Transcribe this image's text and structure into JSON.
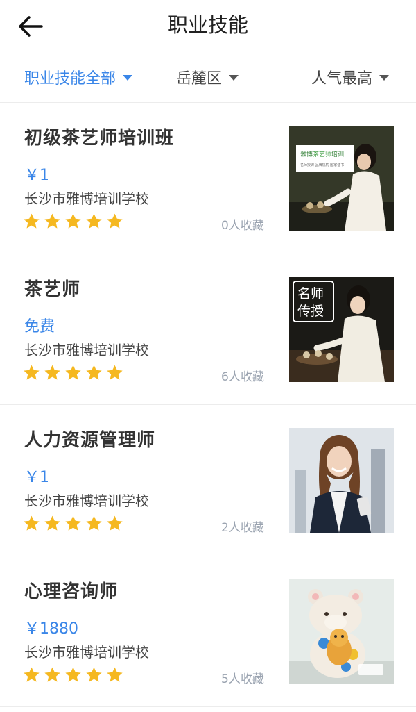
{
  "header": {
    "title": "职业技能",
    "back_icon": "arrow-left-icon"
  },
  "filters": [
    {
      "label": "职业技能全部",
      "active": true
    },
    {
      "label": "岳麓区",
      "active": false
    },
    {
      "label": "人气最高",
      "active": false
    }
  ],
  "colors": {
    "accent": "#3a86e8",
    "star": "#f5b820",
    "muted": "#9aa3b0"
  },
  "courses": [
    {
      "title": "初级茶艺师培训班",
      "price": "￥1",
      "school": "长沙市雅博培训学校",
      "rating": 5,
      "favorites": "0人收藏",
      "image_text": {
        "brand_a": "雅博",
        "brand_b": "茶艺师",
        "brand_c": "培训",
        "sub": "名师授课·品牌机构·国家证书"
      }
    },
    {
      "title": "茶艺师",
      "price": "免费",
      "school": "长沙市雅博培训学校",
      "rating": 5,
      "favorites": "6人收藏",
      "image_text": {
        "line1": "名师",
        "line2": "传授"
      }
    },
    {
      "title": "人力资源管理师",
      "price": "￥1",
      "school": "长沙市雅博培训学校",
      "rating": 5,
      "favorites": "2人收藏"
    },
    {
      "title": "心理咨询师",
      "price": "￥1880",
      "school": "长沙市雅博培训学校",
      "rating": 5,
      "favorites": "5人收藏"
    }
  ]
}
